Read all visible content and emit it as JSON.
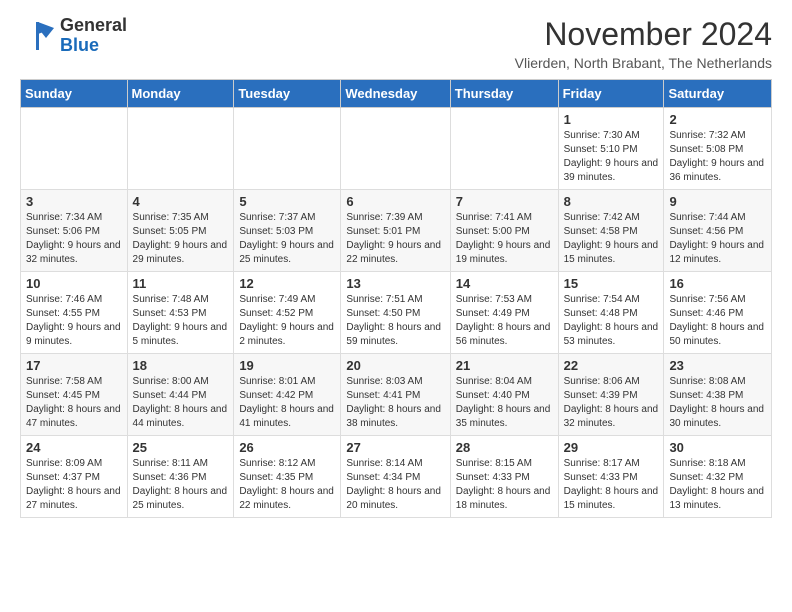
{
  "header": {
    "logo_line1": "General",
    "logo_line2": "Blue",
    "month_title": "November 2024",
    "location": "Vlierden, North Brabant, The Netherlands"
  },
  "days_of_week": [
    "Sunday",
    "Monday",
    "Tuesday",
    "Wednesday",
    "Thursday",
    "Friday",
    "Saturday"
  ],
  "weeks": [
    [
      {
        "day": "",
        "info": ""
      },
      {
        "day": "",
        "info": ""
      },
      {
        "day": "",
        "info": ""
      },
      {
        "day": "",
        "info": ""
      },
      {
        "day": "",
        "info": ""
      },
      {
        "day": "1",
        "info": "Sunrise: 7:30 AM\nSunset: 5:10 PM\nDaylight: 9 hours and 39 minutes."
      },
      {
        "day": "2",
        "info": "Sunrise: 7:32 AM\nSunset: 5:08 PM\nDaylight: 9 hours and 36 minutes."
      }
    ],
    [
      {
        "day": "3",
        "info": "Sunrise: 7:34 AM\nSunset: 5:06 PM\nDaylight: 9 hours and 32 minutes."
      },
      {
        "day": "4",
        "info": "Sunrise: 7:35 AM\nSunset: 5:05 PM\nDaylight: 9 hours and 29 minutes."
      },
      {
        "day": "5",
        "info": "Sunrise: 7:37 AM\nSunset: 5:03 PM\nDaylight: 9 hours and 25 minutes."
      },
      {
        "day": "6",
        "info": "Sunrise: 7:39 AM\nSunset: 5:01 PM\nDaylight: 9 hours and 22 minutes."
      },
      {
        "day": "7",
        "info": "Sunrise: 7:41 AM\nSunset: 5:00 PM\nDaylight: 9 hours and 19 minutes."
      },
      {
        "day": "8",
        "info": "Sunrise: 7:42 AM\nSunset: 4:58 PM\nDaylight: 9 hours and 15 minutes."
      },
      {
        "day": "9",
        "info": "Sunrise: 7:44 AM\nSunset: 4:56 PM\nDaylight: 9 hours and 12 minutes."
      }
    ],
    [
      {
        "day": "10",
        "info": "Sunrise: 7:46 AM\nSunset: 4:55 PM\nDaylight: 9 hours and 9 minutes."
      },
      {
        "day": "11",
        "info": "Sunrise: 7:48 AM\nSunset: 4:53 PM\nDaylight: 9 hours and 5 minutes."
      },
      {
        "day": "12",
        "info": "Sunrise: 7:49 AM\nSunset: 4:52 PM\nDaylight: 9 hours and 2 minutes."
      },
      {
        "day": "13",
        "info": "Sunrise: 7:51 AM\nSunset: 4:50 PM\nDaylight: 8 hours and 59 minutes."
      },
      {
        "day": "14",
        "info": "Sunrise: 7:53 AM\nSunset: 4:49 PM\nDaylight: 8 hours and 56 minutes."
      },
      {
        "day": "15",
        "info": "Sunrise: 7:54 AM\nSunset: 4:48 PM\nDaylight: 8 hours and 53 minutes."
      },
      {
        "day": "16",
        "info": "Sunrise: 7:56 AM\nSunset: 4:46 PM\nDaylight: 8 hours and 50 minutes."
      }
    ],
    [
      {
        "day": "17",
        "info": "Sunrise: 7:58 AM\nSunset: 4:45 PM\nDaylight: 8 hours and 47 minutes."
      },
      {
        "day": "18",
        "info": "Sunrise: 8:00 AM\nSunset: 4:44 PM\nDaylight: 8 hours and 44 minutes."
      },
      {
        "day": "19",
        "info": "Sunrise: 8:01 AM\nSunset: 4:42 PM\nDaylight: 8 hours and 41 minutes."
      },
      {
        "day": "20",
        "info": "Sunrise: 8:03 AM\nSunset: 4:41 PM\nDaylight: 8 hours and 38 minutes."
      },
      {
        "day": "21",
        "info": "Sunrise: 8:04 AM\nSunset: 4:40 PM\nDaylight: 8 hours and 35 minutes."
      },
      {
        "day": "22",
        "info": "Sunrise: 8:06 AM\nSunset: 4:39 PM\nDaylight: 8 hours and 32 minutes."
      },
      {
        "day": "23",
        "info": "Sunrise: 8:08 AM\nSunset: 4:38 PM\nDaylight: 8 hours and 30 minutes."
      }
    ],
    [
      {
        "day": "24",
        "info": "Sunrise: 8:09 AM\nSunset: 4:37 PM\nDaylight: 8 hours and 27 minutes."
      },
      {
        "day": "25",
        "info": "Sunrise: 8:11 AM\nSunset: 4:36 PM\nDaylight: 8 hours and 25 minutes."
      },
      {
        "day": "26",
        "info": "Sunrise: 8:12 AM\nSunset: 4:35 PM\nDaylight: 8 hours and 22 minutes."
      },
      {
        "day": "27",
        "info": "Sunrise: 8:14 AM\nSunset: 4:34 PM\nDaylight: 8 hours and 20 minutes."
      },
      {
        "day": "28",
        "info": "Sunrise: 8:15 AM\nSunset: 4:33 PM\nDaylight: 8 hours and 18 minutes."
      },
      {
        "day": "29",
        "info": "Sunrise: 8:17 AM\nSunset: 4:33 PM\nDaylight: 8 hours and 15 minutes."
      },
      {
        "day": "30",
        "info": "Sunrise: 8:18 AM\nSunset: 4:32 PM\nDaylight: 8 hours and 13 minutes."
      }
    ]
  ]
}
